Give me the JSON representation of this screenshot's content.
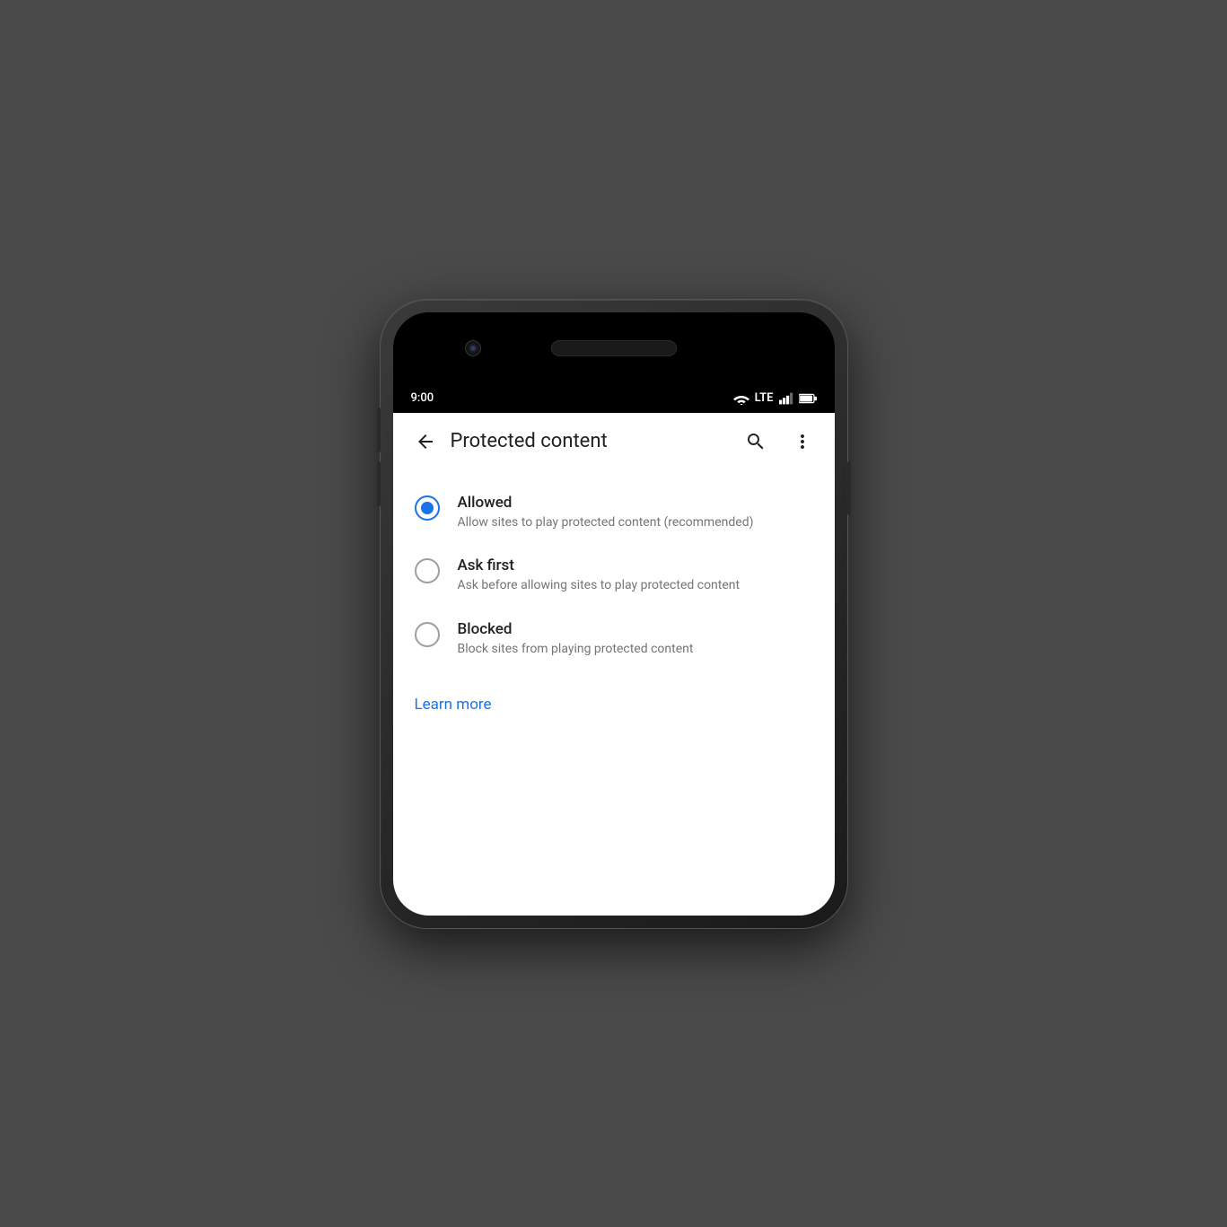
{
  "statusBar": {
    "time": "9:00",
    "wifi": "wifi",
    "lte": "LTE",
    "signal": "signal",
    "battery": "battery"
  },
  "appBar": {
    "backLabel": "←",
    "title": "Protected content",
    "searchTooltip": "Search",
    "moreTooltip": "More options"
  },
  "options": [
    {
      "id": "allowed",
      "title": "Allowed",
      "description": "Allow sites to play protected content (recommended)",
      "selected": true
    },
    {
      "id": "ask-first",
      "title": "Ask first",
      "description": "Ask before allowing sites to play protected content",
      "selected": false
    },
    {
      "id": "blocked",
      "title": "Blocked",
      "description": "Block sites from playing protected content",
      "selected": false
    }
  ],
  "learnMore": {
    "label": "Learn more"
  },
  "colors": {
    "accent": "#1a73e8",
    "textPrimary": "#212121",
    "textSecondary": "#757575"
  }
}
